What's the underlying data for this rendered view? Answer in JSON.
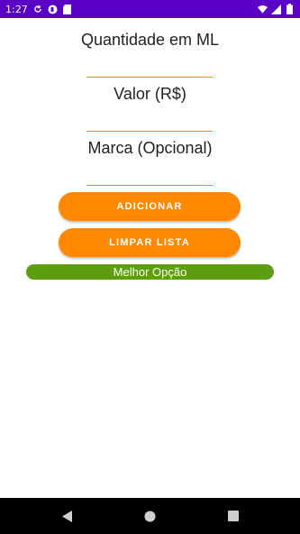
{
  "status_bar": {
    "time": "1:27",
    "color": "#5a00c7",
    "icons_left": [
      "sync-icon",
      "app-badge-icon",
      "sd-card-icon"
    ],
    "icons_right": [
      "wifi-icon",
      "signal-icon",
      "battery-icon"
    ]
  },
  "form": {
    "quantity_label": "Quantidade em ML",
    "value_label": "Valor (R$)",
    "brand_label": "Marca (Opcional)",
    "underline_color": "#ff8a00"
  },
  "buttons": {
    "add_label": "ADICIONAR",
    "clear_label": "LIMPAR LISTA",
    "color": "#ff8800"
  },
  "result": {
    "best_option_label": "Melhor Opção",
    "color": "#5c9e0f"
  },
  "nav": {
    "icons": [
      "back-icon",
      "home-icon",
      "recents-icon"
    ]
  }
}
